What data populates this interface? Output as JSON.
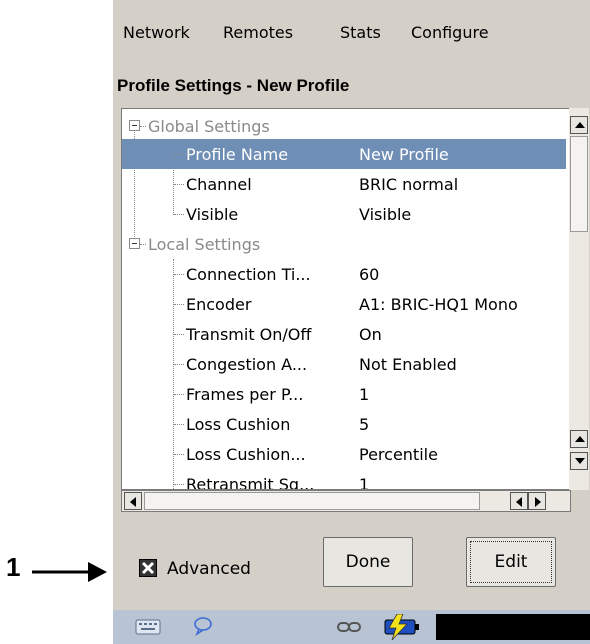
{
  "callout": {
    "number": "1"
  },
  "menu": [
    "Network",
    "Remotes",
    "Stats",
    "Configure"
  ],
  "title": "Profile Settings - New Profile",
  "tree": {
    "global_group": "Global Settings",
    "global_rows": [
      {
        "name": "Profile Name",
        "value": "New Profile",
        "selected": true
      },
      {
        "name": "Channel",
        "value": "BRIC normal"
      },
      {
        "name": "Visible",
        "value": "Visible"
      }
    ],
    "local_group": "Local Settings",
    "local_rows": [
      {
        "name": "Connection Ti...",
        "value": "60"
      },
      {
        "name": "Encoder",
        "value": "A1: BRIC-HQ1 Mono"
      },
      {
        "name": "Transmit On/Off",
        "value": "On"
      },
      {
        "name": "Congestion A...",
        "value": "Not Enabled"
      },
      {
        "name": "Frames per P...",
        "value": "1"
      },
      {
        "name": "Loss Cushion",
        "value": "5"
      },
      {
        "name": "Loss Cushion...",
        "value": "Percentile"
      },
      {
        "name": "Retransmit Sq...",
        "value": "1"
      }
    ]
  },
  "advanced": {
    "label": "Advanced",
    "checked": true
  },
  "buttons": {
    "done": "Done",
    "edit": "Edit"
  },
  "colors": {
    "selection": "#6f8eb5",
    "window": "#d4d0c8",
    "statusbar": "#b8c4d4"
  },
  "status_icons": [
    "keyboard-icon",
    "chat-bubble-icon",
    "link-icon",
    "battery-charging-icon"
  ]
}
